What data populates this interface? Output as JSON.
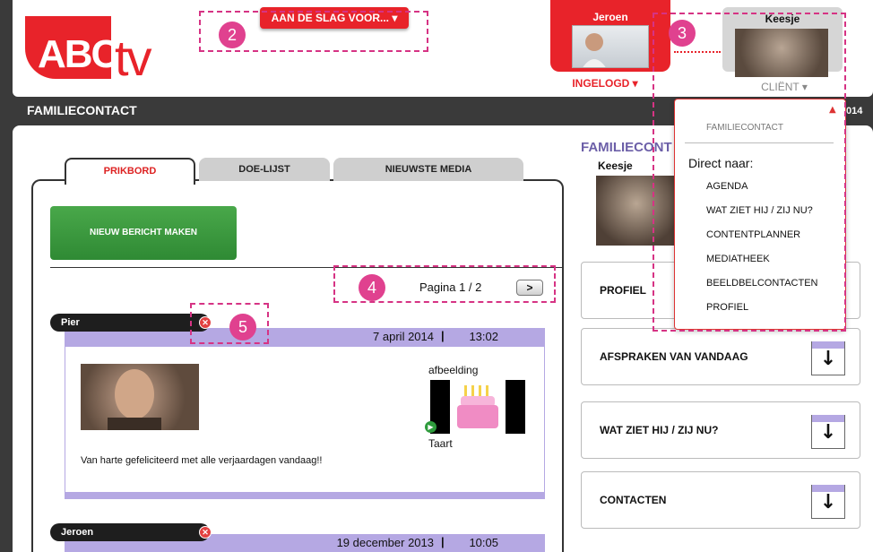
{
  "header": {
    "logo_text_left": "ABC",
    "logo_text_right": "tv",
    "start_button": "AAN DE SLAG VOOR... ▾",
    "user": {
      "name": "Jeroen",
      "status": "INGELOGD ▾"
    },
    "client": {
      "name": "Keesje",
      "label": "CLIËNT ▾"
    }
  },
  "title_bar": {
    "title": "FAMILIECONTACT",
    "year_fragment": "014"
  },
  "tabs": [
    "PRIKBORD",
    "DOE-LIJST",
    "NIEUWSTE MEDIA"
  ],
  "new_message_button": "NIEUW BERICHT MAKEN",
  "pagination": {
    "text": "Pagina 1 / 2",
    "next": ">"
  },
  "messages": [
    {
      "author": "Pier",
      "date": "7 april 2014",
      "separator": "|",
      "time": "13:02",
      "attachment_label": "afbeelding",
      "attachment_name": "Taart",
      "text": "Van harte gefeliciteerd met alle verjaardagen vandaag!!"
    },
    {
      "author": "Jeroen",
      "date": "19 december 2013",
      "separator": "|",
      "time": "10:05"
    }
  ],
  "right_column": {
    "heading": "FAMILIECONT",
    "client_name": "Keesje",
    "boxes": [
      "PROFIEL",
      "AFSPRAKEN VAN VANDAAG",
      "WAT ZIET HIJ / ZIJ NU?",
      "CONTACTEN"
    ]
  },
  "dropdown": {
    "header": "FAMILIECONTACT",
    "subtitle": "Direct naar:",
    "items": [
      "AGENDA",
      "WAT ZIET HIJ / ZIJ NU?",
      "CONTENTPLANNER",
      "MEDIATHEEK",
      "BEELDBELCONTACTEN",
      "PROFIEL"
    ]
  },
  "annotations": [
    "2",
    "3",
    "4",
    "5"
  ],
  "colors": {
    "brand_red": "#e8232a",
    "accent_purple": "#b5a8e3",
    "annotation_pink": "#e0418f",
    "button_green": "#3a9a3f"
  }
}
